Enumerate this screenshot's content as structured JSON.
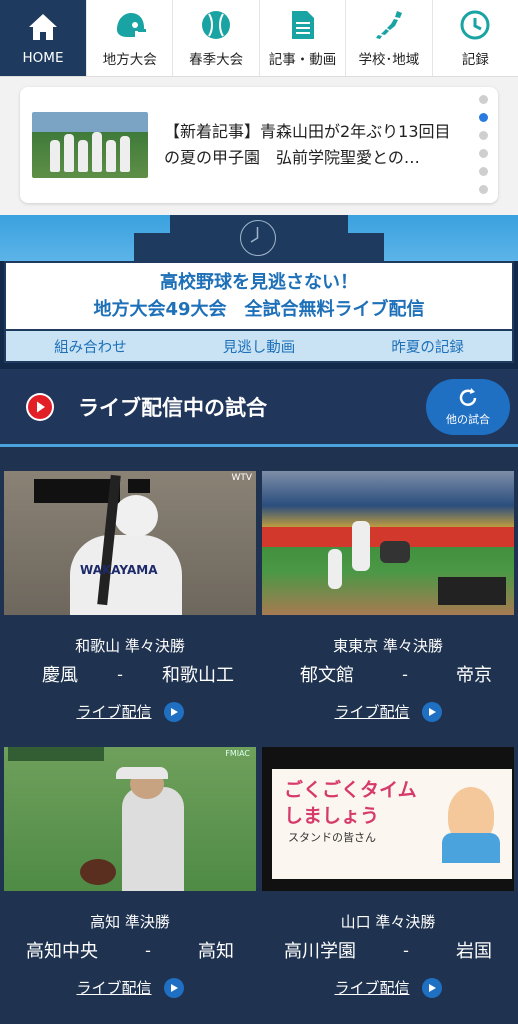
{
  "nav": {
    "items": [
      {
        "label": "HOME",
        "icon": "home-icon"
      },
      {
        "label": "地方大会",
        "icon": "helmet-icon"
      },
      {
        "label": "春季大会",
        "icon": "baseball-icon"
      },
      {
        "label": "記事・動画",
        "icon": "document-icon"
      },
      {
        "label": "学校･地域",
        "icon": "japan-map-icon"
      },
      {
        "label": "記録",
        "icon": "clock-icon"
      }
    ]
  },
  "news": {
    "text": "【新着記事】青森山田が2年ぶり13回目の夏の甲子園　弘前学院聖愛との…"
  },
  "promo": {
    "line1": "高校野球を見逃さない！",
    "line2": "地方大会49大会　全試合無料ライブ配信",
    "links": [
      "組み合わせ",
      "見逃し動画",
      "昨夏の記録"
    ]
  },
  "live": {
    "title": "ライブ配信中の試合",
    "other_label": "他の試合"
  },
  "games": [
    {
      "round": "和歌山 準々決勝",
      "team1": "慶風",
      "sep": "-",
      "team2": "和歌山工",
      "live_label": "ライブ配信"
    },
    {
      "round": "東東京 準々決勝",
      "team1": "郁文館",
      "sep": "-",
      "team2": "帝京",
      "live_label": "ライブ配信"
    },
    {
      "round": "高知 準決勝",
      "team1": "高知中央",
      "sep": "-",
      "team2": "高知",
      "live_label": "ライブ配信"
    },
    {
      "round": "山口 準々決勝",
      "team1": "高川学園",
      "sep": "-",
      "team2": "岩国",
      "live_label": "ライブ配信"
    }
  ],
  "thumbs": {
    "g1_uniform": "WAKAYAMA",
    "g1_corner": "WTV",
    "g3_corner": "FMIAC",
    "g4_sign1": "ごくごくタイム",
    "g4_sign2": "しましょう",
    "g4_sign3": "スタンドの皆さん"
  },
  "colors": {
    "navy": "#1e3a5f",
    "accent_blue": "#1f6fc3",
    "sky": "#4aa3dd"
  }
}
